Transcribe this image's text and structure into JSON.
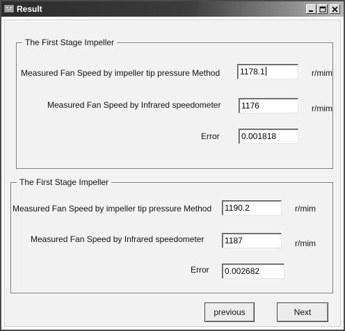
{
  "window": {
    "title": "Result"
  },
  "titlebar_buttons": {
    "minimize_icon": "minimize-icon",
    "maximize_icon": "maximize-icon",
    "close_icon": "close-icon"
  },
  "groups": [
    {
      "legend": "The First Stage Impeller",
      "tip_label": "Measured Fan Speed by impeller tip pressure Method",
      "tip_value": "1178.1",
      "tip_unit": "r/mim",
      "infrared_label": "Measured Fan Speed by Infrared speedometer",
      "infrared_value": "1176",
      "infrared_unit": "r/mim",
      "error_label": "Error",
      "error_value": "0.001818"
    },
    {
      "legend": "The First Stage Impeller",
      "tip_label": "Measured Fan Speed by impeller tip pressure Method",
      "tip_value": "1190.2",
      "tip_unit": "r/mim",
      "infrared_label": "Measured Fan Speed by Infrared speedometer",
      "infrared_value": "1187",
      "infrared_unit": "r/mim",
      "error_label": "Error",
      "error_value": "0.002682"
    }
  ],
  "buttons": {
    "previous": "previous",
    "next": "Next"
  }
}
